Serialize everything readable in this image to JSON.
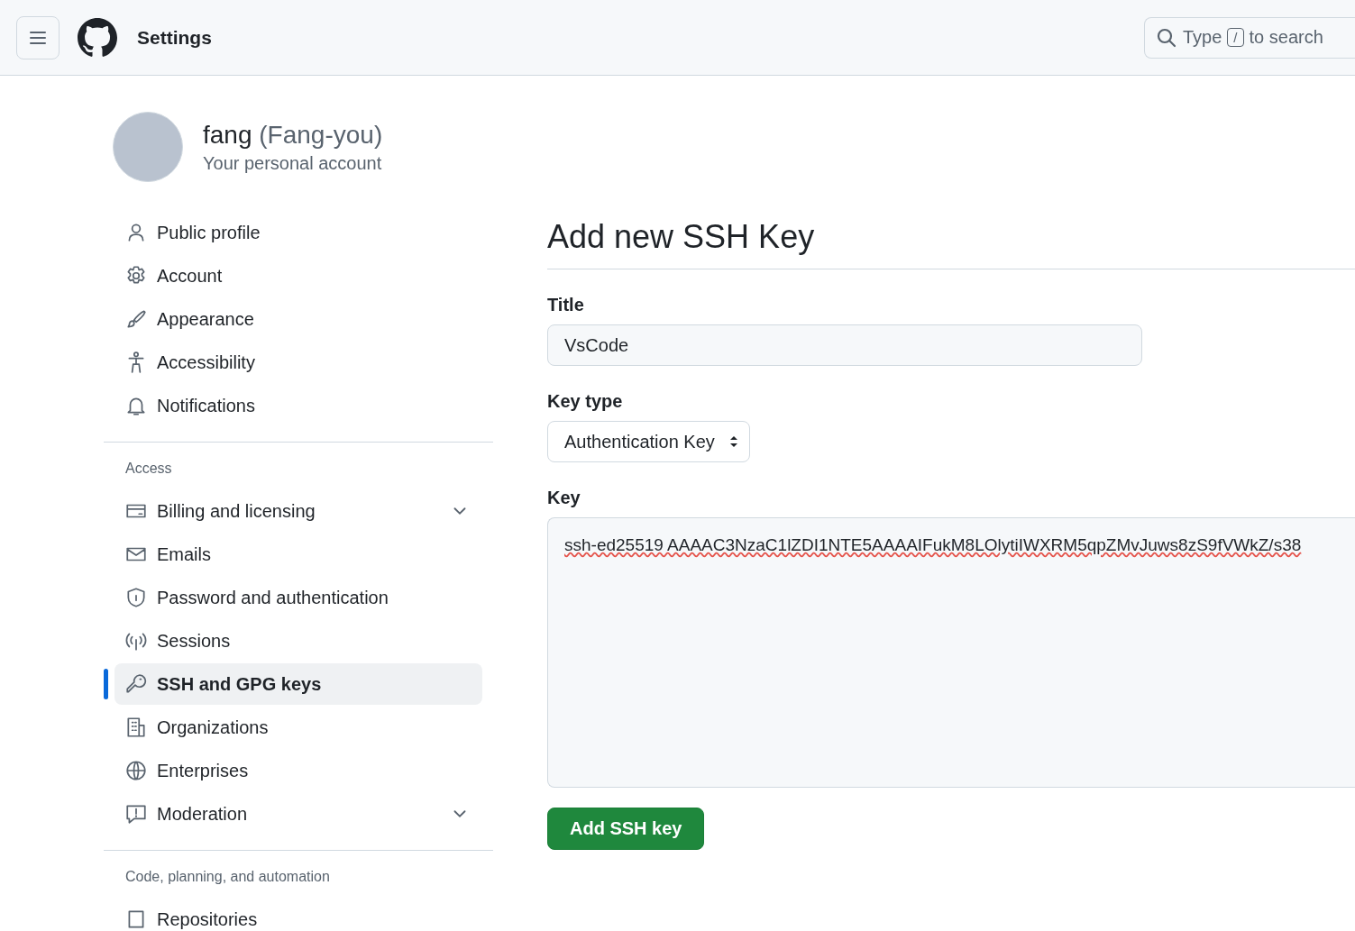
{
  "header": {
    "title": "Settings",
    "search": {
      "placeholder_before": "Type",
      "shortcut": "/",
      "placeholder_after": "to search"
    }
  },
  "profile": {
    "name": "fang",
    "login": "(Fang-you)",
    "subtitle": "Your personal account"
  },
  "sidebar": {
    "groups": [
      {
        "items": [
          {
            "label": "Public profile",
            "selected": false,
            "expandable": false
          },
          {
            "label": "Account",
            "selected": false,
            "expandable": false
          },
          {
            "label": "Appearance",
            "selected": false,
            "expandable": false
          },
          {
            "label": "Accessibility",
            "selected": false,
            "expandable": false
          },
          {
            "label": "Notifications",
            "selected": false,
            "expandable": false
          }
        ]
      },
      {
        "heading": "Access",
        "items": [
          {
            "label": "Billing and licensing",
            "selected": false,
            "expandable": true
          },
          {
            "label": "Emails",
            "selected": false,
            "expandable": false
          },
          {
            "label": "Password and authentication",
            "selected": false,
            "expandable": false
          },
          {
            "label": "Sessions",
            "selected": false,
            "expandable": false
          },
          {
            "label": "SSH and GPG keys",
            "selected": true,
            "expandable": false
          },
          {
            "label": "Organizations",
            "selected": false,
            "expandable": false
          },
          {
            "label": "Enterprises",
            "selected": false,
            "expandable": false
          },
          {
            "label": "Moderation",
            "selected": false,
            "expandable": true
          }
        ]
      },
      {
        "heading": "Code, planning, and automation",
        "items": [
          {
            "label": "Repositories",
            "selected": false,
            "expandable": false
          }
        ]
      }
    ]
  },
  "form": {
    "heading": "Add new SSH Key",
    "title_label": "Title",
    "title_value": "VsCode",
    "key_type_label": "Key type",
    "key_type_value": "Authentication Key",
    "key_label": "Key",
    "key_value": "ssh-ed25519 AAAAC3NzaC1lZDI1NTE5AAAAIFukM8LOlytiIWXRM5qpZMvJuws8zS9fVWkZ/s38",
    "submit": "Add SSH key"
  }
}
